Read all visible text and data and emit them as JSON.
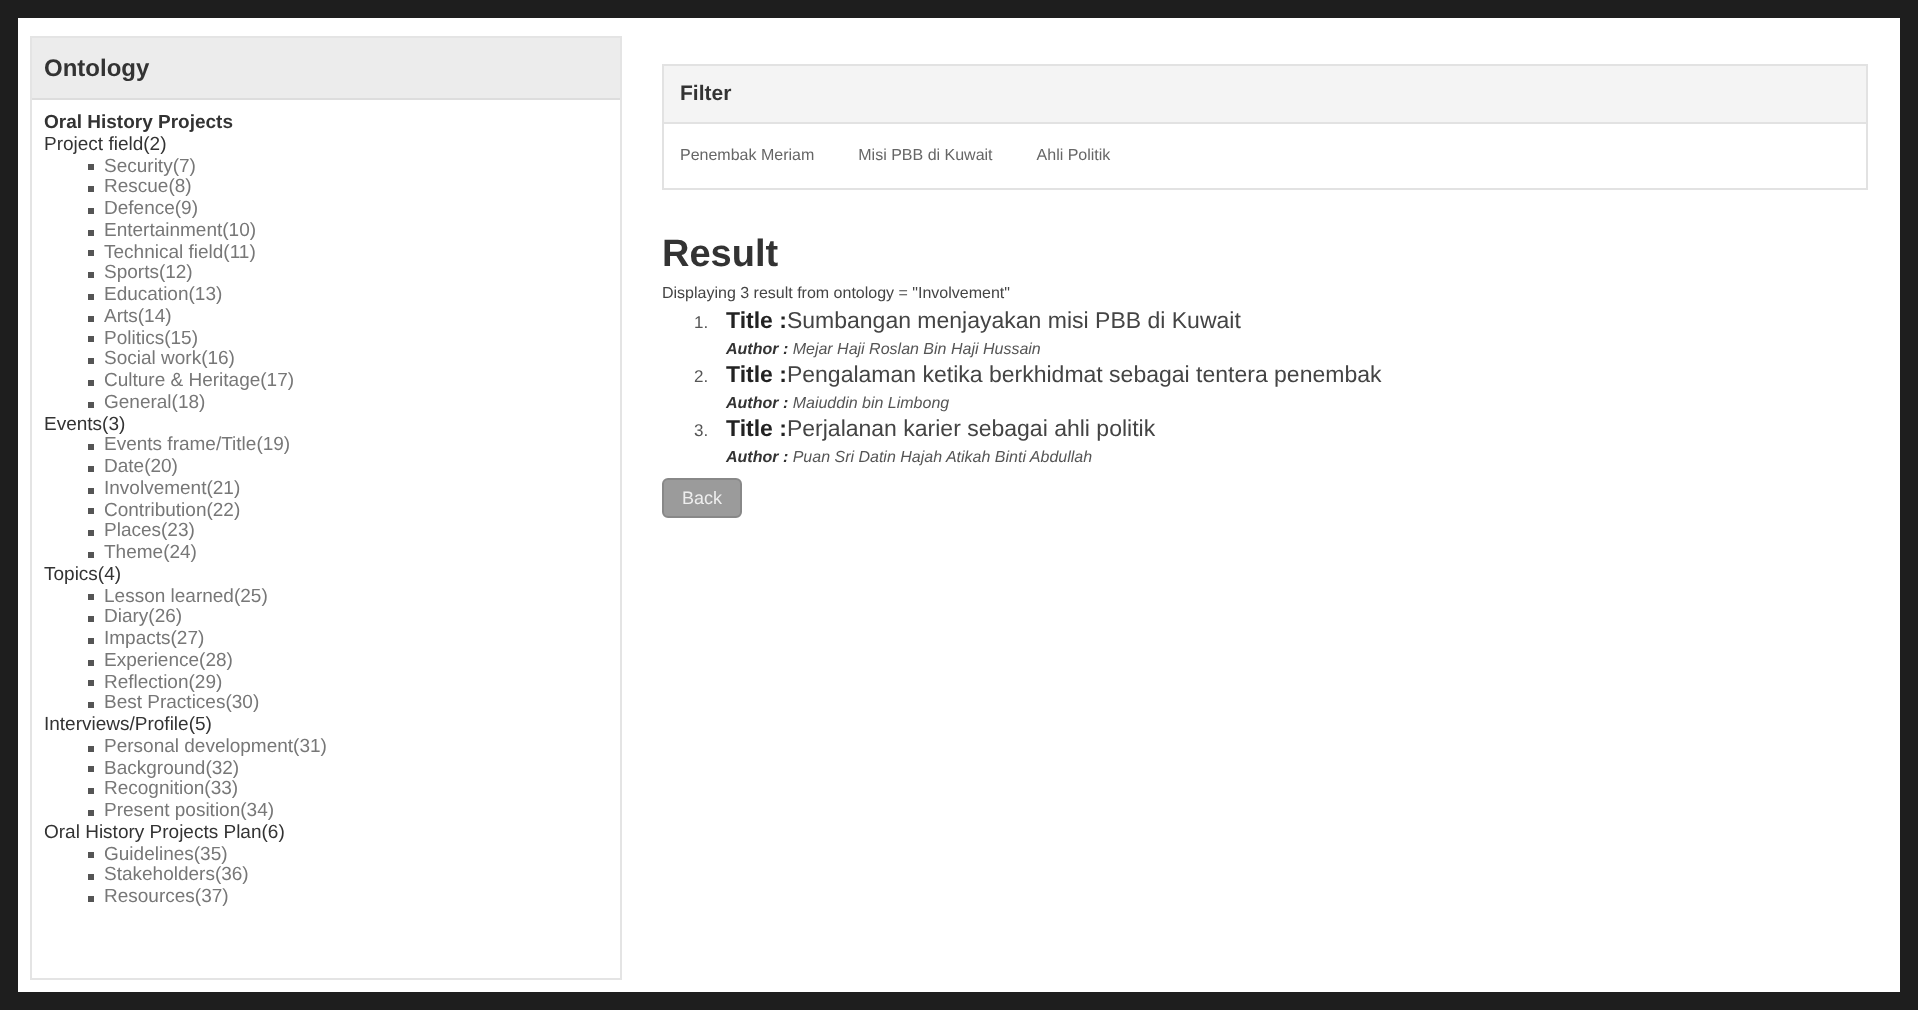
{
  "ontology": {
    "title": "Ontology",
    "root": "Oral History Projects",
    "groups": [
      {
        "label": "Project field(2)",
        "children": [
          {
            "label": "Security(7)"
          },
          {
            "label": "Rescue(8)"
          },
          {
            "label": "Defence(9)"
          },
          {
            "label": "Entertainment(10)"
          },
          {
            "label": "Technical field(11)"
          },
          {
            "label": "Sports(12)"
          },
          {
            "label": "Education(13)"
          },
          {
            "label": "Arts(14)"
          },
          {
            "label": "Politics(15)"
          },
          {
            "label": "Social work(16)"
          },
          {
            "label": "Culture & Heritage(17)"
          },
          {
            "label": "General(18)"
          }
        ]
      },
      {
        "label": "Events(3)",
        "children": [
          {
            "label": "Events frame/Title(19)"
          },
          {
            "label": "Date(20)"
          },
          {
            "label": "Involvement(21)"
          },
          {
            "label": "Contribution(22)"
          },
          {
            "label": "Places(23)"
          },
          {
            "label": "Theme(24)"
          }
        ]
      },
      {
        "label": "Topics(4)",
        "children": [
          {
            "label": "Lesson learned(25)"
          },
          {
            "label": "Diary(26)"
          },
          {
            "label": "Impacts(27)"
          },
          {
            "label": "Experience(28)"
          },
          {
            "label": "Reflection(29)"
          },
          {
            "label": "Best Practices(30)"
          }
        ]
      },
      {
        "label": "Interviews/Profile(5)",
        "children": [
          {
            "label": "Personal development(31)"
          },
          {
            "label": "Background(32)"
          },
          {
            "label": "Recognition(33)"
          },
          {
            "label": "Present position(34)"
          }
        ]
      },
      {
        "label": "Oral History Projects Plan(6)",
        "children": [
          {
            "label": "Guidelines(35)"
          },
          {
            "label": "Stakeholders(36)"
          },
          {
            "label": "Resources(37)"
          }
        ]
      }
    ]
  },
  "filter": {
    "title": "Filter",
    "links": [
      "Penembak Meriam",
      "Misi PBB di Kuwait",
      "Ahli Politik"
    ]
  },
  "result": {
    "heading": "Result",
    "summary": "Displaying 3 result from ontology = \"Involvement\"",
    "items": [
      {
        "number": "1.",
        "title_label": "Title :",
        "title": "Sumbangan menjayakan misi PBB di Kuwait",
        "author_label": "Author :",
        "author": "Mejar Haji Roslan Bin Haji Hussain"
      },
      {
        "number": "2.",
        "title_label": "Title :",
        "title": "Pengalaman ketika berkhidmat sebagai tentera penembak",
        "author_label": "Author :",
        "author": "Maiuddin bin Limbong"
      },
      {
        "number": "3.",
        "title_label": "Title :",
        "title": "Perjalanan karier sebagai ahli politik",
        "author_label": "Author :",
        "author": "Puan Sri Datin Hajah Atikah Binti Abdullah"
      }
    ],
    "back_button": "Back"
  }
}
